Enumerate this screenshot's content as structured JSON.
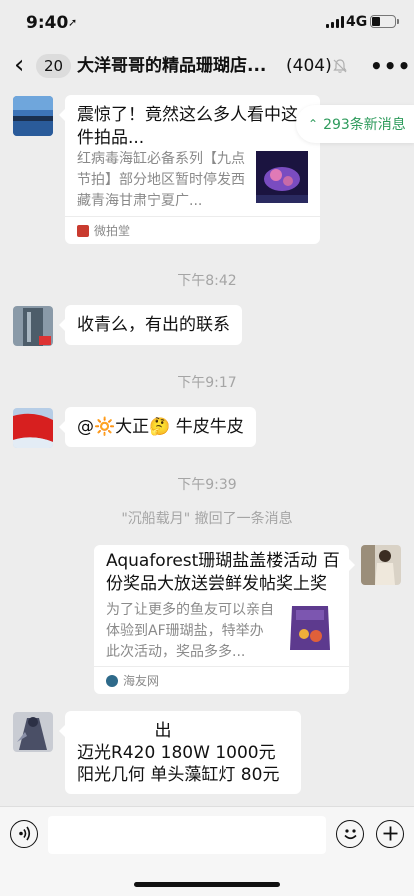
{
  "status_bar": {
    "time": "9:40",
    "location_glyph": "➚",
    "network": "4G"
  },
  "header": {
    "back_glyph": "‹",
    "unread_count": "20",
    "title": "大洋哥哥的精品珊瑚店...",
    "member_count": "(404)",
    "more_glyph": "•••"
  },
  "new_messages": {
    "chevron": "⌃",
    "label": "293条新消息"
  },
  "messages": {
    "card1": {
      "title": "震惊了！竟然这么多人看中这件拍品...",
      "description": "红病毒海缸必备系列【九点节拍】部分地区暂时停发西藏青海甘肃宁夏广...",
      "source": "微拍堂"
    },
    "time1": "下午8:42",
    "msg2": "收青么，有出的联系",
    "time2": "下午9:17",
    "msg3": "@🔆大正🤔 牛皮牛皮",
    "time3": "下午9:39",
    "recall": "\"沉船载月\" 撤回了一条消息",
    "card2": {
      "title": "Aquaforest珊瑚盐盖楼活动 百份奖品大放送尝鲜发帖奖上奖",
      "description": "为了让更多的鱼友可以亲自体验到AF珊瑚盐，特举办此次活动，奖品多多...",
      "source": "海友网"
    },
    "msg5": {
      "line1": "出",
      "line2": "迈光R420  180W  1000元",
      "line3": "阳光几何 单头藻缸灯   80元"
    }
  },
  "input_bar": {
    "voice_icon": "voice-icon",
    "emoji_icon": "emoji-icon",
    "add_icon": "plus-icon"
  },
  "colors": {
    "background": "#ededed",
    "bubble": "#ffffff",
    "accent_green": "#2e9b5c",
    "timestamp": "#a5a5a5"
  }
}
